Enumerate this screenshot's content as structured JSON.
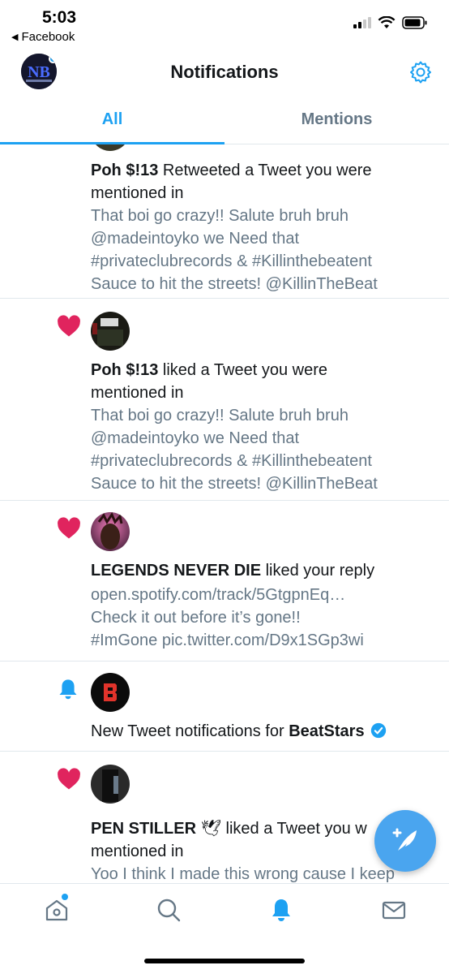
{
  "status_bar": {
    "time": "5:03",
    "back_app": "Facebook"
  },
  "header": {
    "title": "Notifications"
  },
  "tabs": [
    {
      "label": "All",
      "active": true
    },
    {
      "label": "Mentions",
      "active": false
    }
  ],
  "notifications": [
    {
      "kind": "retweet",
      "user": "Poh $!13",
      "action": " Retweeted a Tweet you were",
      "action2": "mentioned in",
      "body": [
        "That boi go crazy!! Salute bruh bruh",
        "@madeintoyko  we Need that",
        "#privateclubrecords & #Killinthebeatent",
        "Sauce to hit the streets!  @KillinTheBeat"
      ]
    },
    {
      "kind": "like",
      "user": "Poh $!13",
      "action": " liked a Tweet you were",
      "action2": "mentioned in",
      "body": [
        "That boi go crazy!! Salute bruh bruh",
        "@madeintoyko  we Need that",
        "#privateclubrecords & #Killinthebeatent",
        "Sauce to hit the streets!  @KillinTheBeat"
      ]
    },
    {
      "kind": "like",
      "user": "LEGENDS NEVER DIE",
      "action": " liked your reply",
      "body": [
        "open.spotify.com/track/5GtgpnEq…",
        "Check it out before it’s gone!!",
        "#ImGone pic.twitter.com/D9x1SGp3wi"
      ]
    },
    {
      "kind": "bell",
      "prefix": "New Tweet notifications for ",
      "user": "BeatStars"
    },
    {
      "kind": "like",
      "user": "PEN STILLER",
      "emoji": "🕊",
      "action": " liked a Tweet you w",
      "action2": "mentioned in",
      "body": [
        "Yoo I think I made this wrong cause I keep"
      ]
    }
  ],
  "colors": {
    "accent": "#1da1f2",
    "like": "#e0245e",
    "muted": "#657786"
  },
  "icons": {
    "nav": [
      "home-icon",
      "search-icon",
      "notifications-bell-icon",
      "messages-envelope-icon"
    ],
    "fab": "compose-tweet-icon"
  }
}
